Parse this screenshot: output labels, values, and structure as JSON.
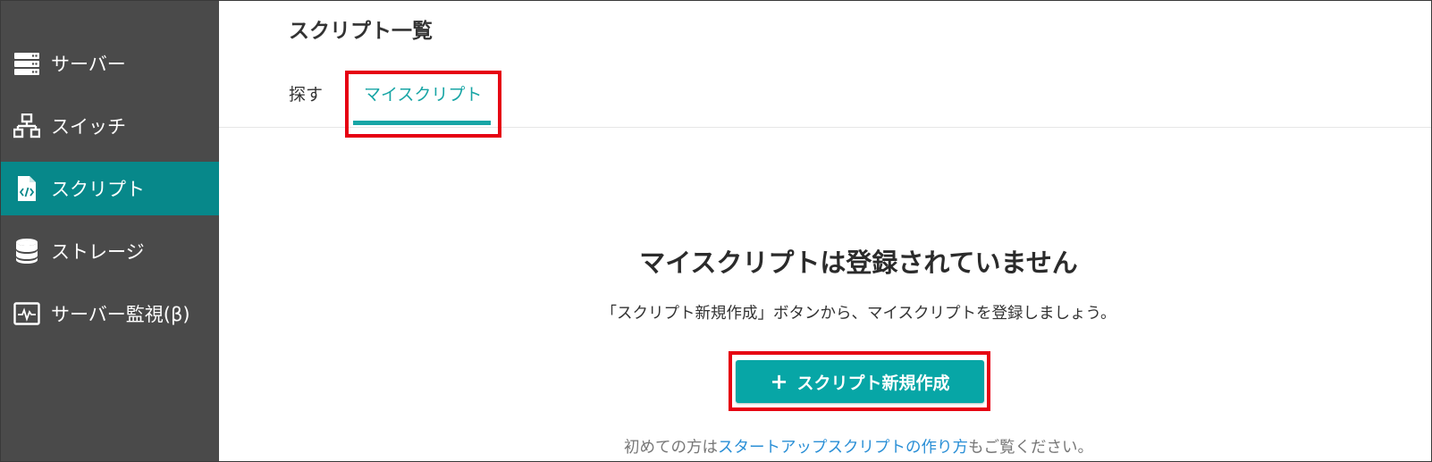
{
  "sidebar": {
    "items": [
      {
        "label": "サーバー",
        "icon": "server-icon",
        "active": false
      },
      {
        "label": "スイッチ",
        "icon": "switch-icon",
        "active": false
      },
      {
        "label": "スクリプト",
        "icon": "script-file-icon",
        "active": true
      },
      {
        "label": "ストレージ",
        "icon": "storage-icon",
        "active": false
      },
      {
        "label": "サーバー監視(β)",
        "icon": "monitor-icon",
        "active": false
      }
    ]
  },
  "main": {
    "title": "スクリプト一覧",
    "tabs": [
      {
        "label": "探す",
        "active": false
      },
      {
        "label": "マイスクリプト",
        "active": true
      }
    ],
    "empty_state": {
      "title": "マイスクリプトは登録されていません",
      "description": "「スクリプト新規作成」ボタンから、マイスクリプトを登録しましょう。",
      "create_button_icon": "+",
      "create_button_label": "スクリプト新規作成",
      "note_prefix": "初めての方は",
      "note_link": "スタートアップスクリプトの作り方",
      "note_suffix": "もご覧ください。"
    }
  },
  "colors": {
    "sidebar_bg": "#4a4a4a",
    "sidebar_active": "#07888a",
    "accent": "#18a5a5",
    "button_bg": "#07a6a6",
    "highlight": "#e60012",
    "link": "#2a8fd6"
  }
}
